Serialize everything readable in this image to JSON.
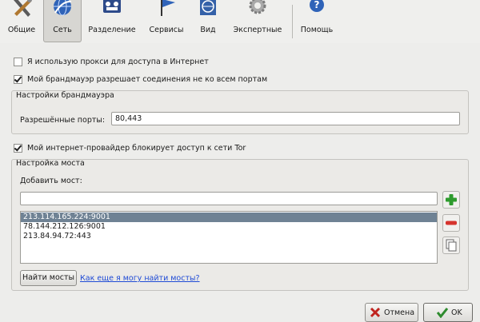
{
  "toolbar": {
    "tabs": [
      {
        "label": "Общие",
        "icon": "tools-icon"
      },
      {
        "label": "Сеть",
        "icon": "globe-network-icon"
      },
      {
        "label": "Разделение",
        "icon": "sharing-icon"
      },
      {
        "label": "Сервисы",
        "icon": "services-flag-icon"
      },
      {
        "label": "Вид",
        "icon": "appearance-icon"
      },
      {
        "label": "Экспертные",
        "icon": "gear-icon"
      },
      {
        "label": "Помощь",
        "icon": "help-icon"
      }
    ],
    "active_tab": "Сеть"
  },
  "network": {
    "proxy_checkbox": {
      "label": "Я использую прокси для доступа в Интернет",
      "checked": false
    },
    "firewall_checkbox": {
      "label": "Мой брандмауэр разрешает соединения не ко всем портам",
      "checked": true
    },
    "firewall_group": {
      "title": "Настройки брандмауэра",
      "ports_label": "Разрешённые порты:",
      "ports_value": "80,443"
    },
    "isp_checkbox": {
      "label": "Мой интернет-провайдер блокирует доступ к сети Tor",
      "checked": true
    },
    "bridge_group": {
      "title": "Настройка моста",
      "add_label": "Добавить мост:",
      "add_value": "",
      "bridges": [
        "213.114.165.224:9001",
        "78.144.212.126:9001",
        "213.84.94.72:443"
      ],
      "selected_index": 0,
      "find_button": "Найти мосты",
      "help_link": "Как еще я могу найти мосты?"
    }
  },
  "dialog": {
    "cancel": "Отмена",
    "ok": "OK"
  },
  "colors": {
    "selection": "#6f8294",
    "link": "#1f4bd6",
    "add": "#2e9b2e",
    "remove": "#d6342e"
  }
}
